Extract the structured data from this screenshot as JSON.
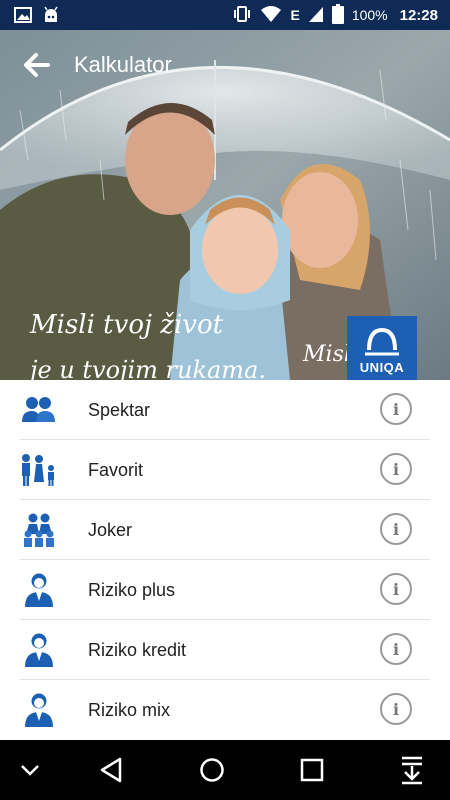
{
  "status_bar": {
    "battery": "100%",
    "network": "E",
    "time": "12:28"
  },
  "header": {
    "title": "Kalkulator"
  },
  "hero": {
    "slogan_line1": "Misli tvoj život",
    "slogan_line2": "je u tvojim rukama.",
    "slogan_brand": "Misli",
    "logo_text": "UNIQA",
    "brand_color": "#1d5fb3"
  },
  "products": [
    {
      "label": "Spektar",
      "icon": "couple-icon",
      "info": "i"
    },
    {
      "label": "Favorit",
      "icon": "family-icon",
      "info": "i"
    },
    {
      "label": "Joker",
      "icon": "group-icon",
      "info": "i"
    },
    {
      "label": "Riziko plus",
      "icon": "person-icon",
      "info": "i"
    },
    {
      "label": "Riziko kredit",
      "icon": "person-icon",
      "info": "i"
    },
    {
      "label": "Riziko mix",
      "icon": "person-icon",
      "info": "i"
    }
  ],
  "colors": {
    "status_bar": "#0e2a55",
    "icon_blue": "#1d5fb3",
    "nav_bar": "#000000"
  }
}
